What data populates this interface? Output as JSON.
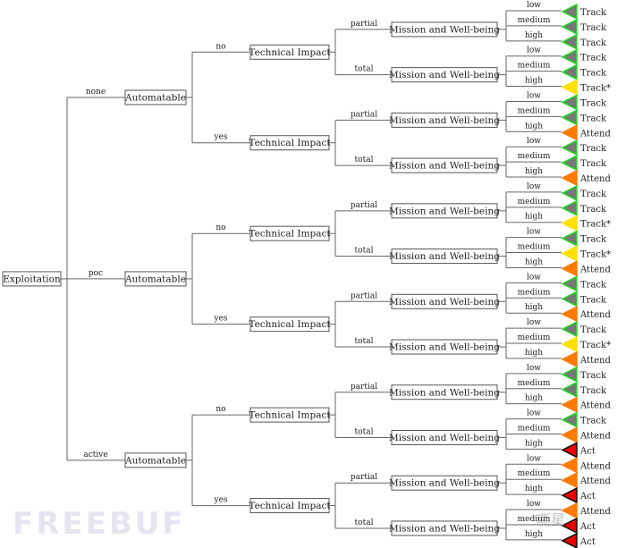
{
  "root": {
    "label": "Exploitation",
    "values": [
      "none",
      "poc",
      "active"
    ]
  },
  "level2": {
    "label": "Automatable",
    "values": [
      "no",
      "yes"
    ]
  },
  "level3": {
    "label": "Technical Impact",
    "values": [
      "partial",
      "total"
    ]
  },
  "level4": {
    "label": "Mission and Well-being",
    "values": [
      "low",
      "medium",
      "high"
    ]
  },
  "outcomes": [
    "Track",
    "Track",
    "Track",
    "Track",
    "Track",
    "Track*",
    "Track",
    "Track",
    "Attend",
    "Track",
    "Track",
    "Attend",
    "Track",
    "Track",
    "Track*",
    "Track",
    "Track*",
    "Attend",
    "Track",
    "Track",
    "Attend",
    "Track",
    "Track*",
    "Attend",
    "Track",
    "Track",
    "Attend",
    "Track",
    "Attend",
    "Act",
    "Attend",
    "Attend",
    "Act",
    "Attend",
    "Act",
    "Act"
  ],
  "outcome_colors": {
    "Track": {
      "fill": "#777777",
      "stroke": "#22dd22"
    },
    "Track*": {
      "fill": "#ffe000",
      "stroke": "#ffe000"
    },
    "Attend": {
      "fill": "#ff7a00",
      "stroke": "#ff7a00"
    },
    "Act": {
      "fill": "#ee0000",
      "stroke": "#111111"
    }
  },
  "watermark": {
    "left": "FREEBUF",
    "right": "嘶星"
  }
}
